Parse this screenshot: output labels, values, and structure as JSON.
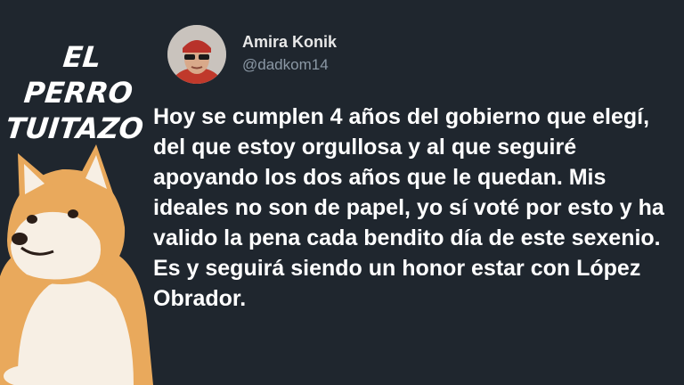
{
  "brand": {
    "line1": "EL PERRO",
    "line2": "TUITAZO"
  },
  "author": {
    "name": "Amira Konik",
    "handle": "@dadkom14"
  },
  "tweet": {
    "text": "Hoy se cumplen 4 años del gobierno que elegí, del que estoy orgullosa y al que seguiré apoyando los dos años que le quedan. Mis ideales no son de papel, yo sí voté por esto y ha valido la pena cada bendito día de este sexenio. Es y seguirá siendo un honor estar con López Obrador."
  },
  "colors": {
    "background": "#1f262e",
    "text": "#ffffff",
    "handle": "#8b98a5"
  },
  "icons": [
    "avatar",
    "doge-illustration"
  ]
}
